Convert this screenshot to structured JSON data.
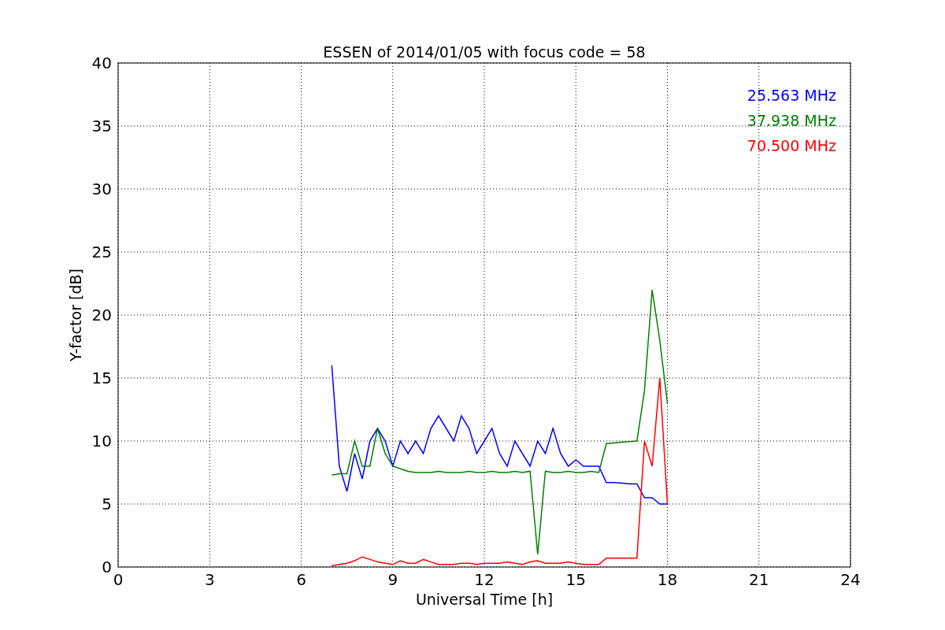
{
  "chart_data": {
    "type": "line",
    "title": "ESSEN of 2014/01/05 with focus code = 58",
    "xlabel": "Universal Time [h]",
    "ylabel": "Y-factor [dB]",
    "x": [
      7,
      7.25,
      7.5,
      7.75,
      8,
      8.25,
      8.5,
      8.75,
      9,
      9.25,
      9.5,
      9.75,
      10,
      10.25,
      10.5,
      10.75,
      11,
      11.25,
      11.5,
      11.75,
      12,
      12.25,
      12.5,
      12.75,
      13,
      13.25,
      13.5,
      13.75,
      14,
      14.25,
      14.5,
      14.75,
      15,
      15.25,
      15.5,
      15.75,
      16,
      16.25,
      16.5,
      16.75,
      17,
      17.25,
      17.5,
      17.75,
      18
    ],
    "series": [
      {
        "name": "25.563 MHz",
        "color": "#0000ff",
        "values": [
          16,
          8,
          6,
          9,
          7,
          10,
          11,
          10,
          8,
          10,
          9,
          10,
          9,
          11,
          12,
          11,
          10,
          12,
          11,
          9,
          10,
          11,
          9,
          8,
          10,
          9,
          8,
          10,
          9,
          11,
          9,
          8,
          8.5,
          8,
          8,
          8,
          6.7,
          6.7,
          6.65,
          6.6,
          6.6,
          5.5,
          5.5,
          5,
          5
        ]
      },
      {
        "name": "37.938 MHz",
        "color": "#008000",
        "values": [
          7.3,
          7.4,
          7.4,
          10,
          8,
          8,
          11,
          9,
          8,
          7.8,
          7.6,
          7.5,
          7.5,
          7.5,
          7.6,
          7.5,
          7.5,
          7.5,
          7.6,
          7.5,
          7.5,
          7.6,
          7.5,
          7.5,
          7.6,
          7.5,
          7.6,
          1,
          7.6,
          7.5,
          7.5,
          7.6,
          7.5,
          7.5,
          7.6,
          7.5,
          9.8,
          9.85,
          9.9,
          9.95,
          10,
          14,
          22,
          18,
          13
        ]
      },
      {
        "name": "70.500 MHz",
        "color": "#ff0000",
        "values": [
          0.1,
          0.2,
          0.3,
          0.5,
          0.8,
          0.6,
          0.4,
          0.3,
          0.2,
          0.5,
          0.3,
          0.3,
          0.6,
          0.4,
          0.2,
          0.2,
          0.2,
          0.3,
          0.3,
          0.2,
          0.3,
          0.3,
          0.3,
          0.4,
          0.3,
          0.2,
          0.4,
          0.5,
          0.3,
          0.3,
          0.3,
          0.4,
          0.3,
          0.2,
          0.2,
          0.2,
          0.7,
          0.7,
          0.7,
          0.7,
          0.7,
          10,
          8,
          15,
          5
        ]
      }
    ],
    "grid": true,
    "xlim": [
      0,
      24
    ],
    "ylim": [
      0,
      40
    ],
    "xticks": [
      0,
      3,
      6,
      9,
      12,
      15,
      18,
      21,
      24
    ],
    "yticks": [
      0,
      5,
      10,
      15,
      20,
      25,
      30,
      35,
      40
    ]
  }
}
